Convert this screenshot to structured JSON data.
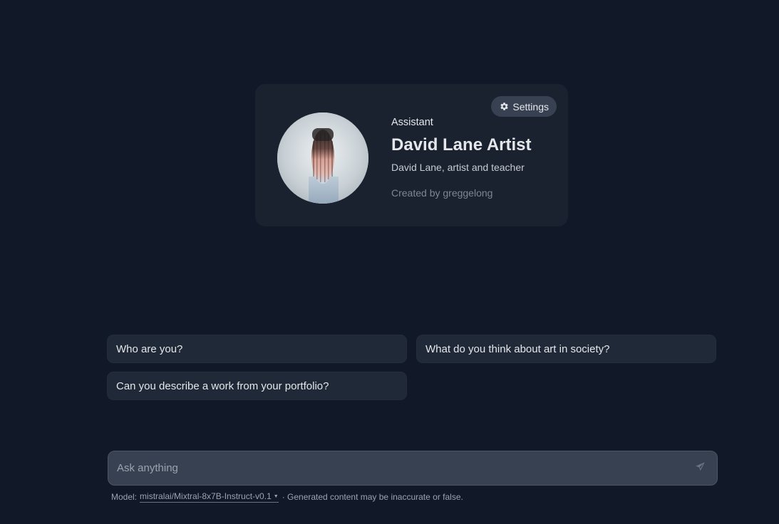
{
  "assistant": {
    "kind": "Assistant",
    "name": "David Lane Artist",
    "description": "David Lane, artist and teacher",
    "creator": "Created by greggelong",
    "avatar_icon": "portrait-avatar"
  },
  "settings": {
    "label": "Settings",
    "icon": "gear-icon"
  },
  "prompts": [
    {
      "label": "Who are you?"
    },
    {
      "label": "What do you think about art in society?"
    },
    {
      "label": "Can you describe a work from your portfolio?"
    }
  ],
  "input": {
    "placeholder": "Ask anything",
    "value": "",
    "send_icon": "send-icon"
  },
  "footer": {
    "model_prefix": "Model:",
    "model_name": "mistralai/Mixtral-8x7B-Instruct-v0.1",
    "disclaimer": "· Generated content may be inaccurate or false."
  },
  "colors": {
    "background": "#111827",
    "card": "#1a2230",
    "chip": "#1f2937",
    "input": "#374151"
  }
}
